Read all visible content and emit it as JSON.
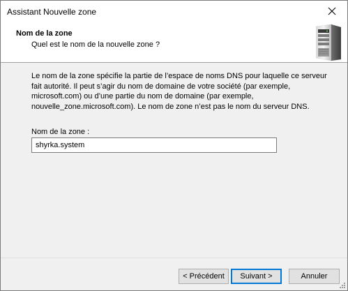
{
  "window": {
    "title": "Assistant Nouvelle zone",
    "close_glyph": "close-icon"
  },
  "header": {
    "title": "Nom de la zone",
    "subtitle": "Quel est le nom de la nouvelle zone ?",
    "icon": "server-icon"
  },
  "body": {
    "description": "Le nom de la zone spécifie la partie de l’espace de noms DNS pour laquelle ce serveur fait autorité. Il peut s’agir du nom de domaine de votre société (par exemple, microsoft.com) ou d’une partie du nom de domaine (par exemple, nouvelle_zone.microsoft.com). Le nom de zone n’est pas le nom du serveur DNS.",
    "zone_label": "Nom de la zone :",
    "zone_value": "shyrka.system"
  },
  "buttons": {
    "previous": "< Précédent",
    "next": "Suivant >",
    "cancel": "Annuler"
  },
  "colors": {
    "focus_border": "#0078d7",
    "button_bg": "#e1e1e1",
    "window_bg": "#f0f0f0"
  }
}
